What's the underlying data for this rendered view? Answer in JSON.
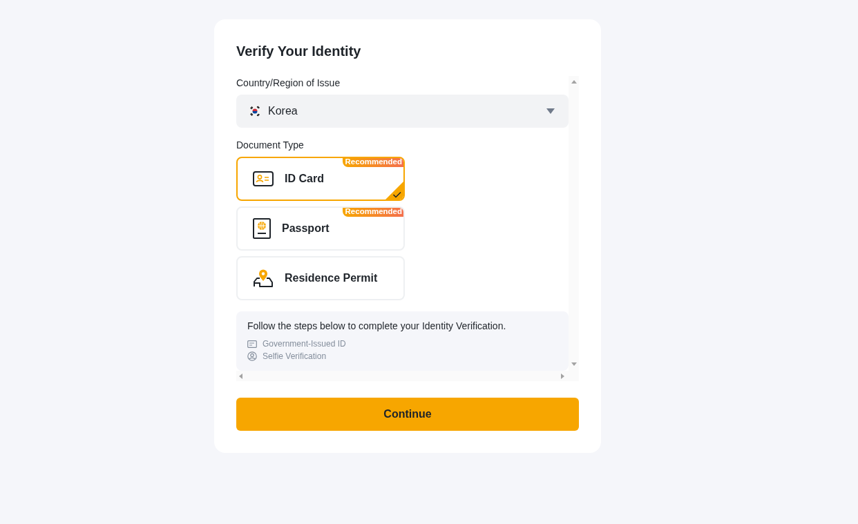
{
  "title": "Verify Your Identity",
  "country": {
    "label": "Country/Region of Issue",
    "value": "Korea"
  },
  "document_type": {
    "label": "Document Type",
    "options": [
      {
        "kind": "id-card",
        "label": "ID Card",
        "badge": "Recommended",
        "selected": true
      },
      {
        "kind": "passport",
        "label": "Passport",
        "badge": "Recommended",
        "selected": false
      },
      {
        "kind": "residence-permit",
        "label": "Residence Permit",
        "selected": false
      }
    ]
  },
  "steps": {
    "intro": "Follow the steps below to complete your Identity Verification.",
    "items": [
      {
        "kind": "document",
        "label": "Government-Issued ID"
      },
      {
        "kind": "selfie",
        "label": "Selfie Verification"
      }
    ]
  },
  "button": "Continue"
}
